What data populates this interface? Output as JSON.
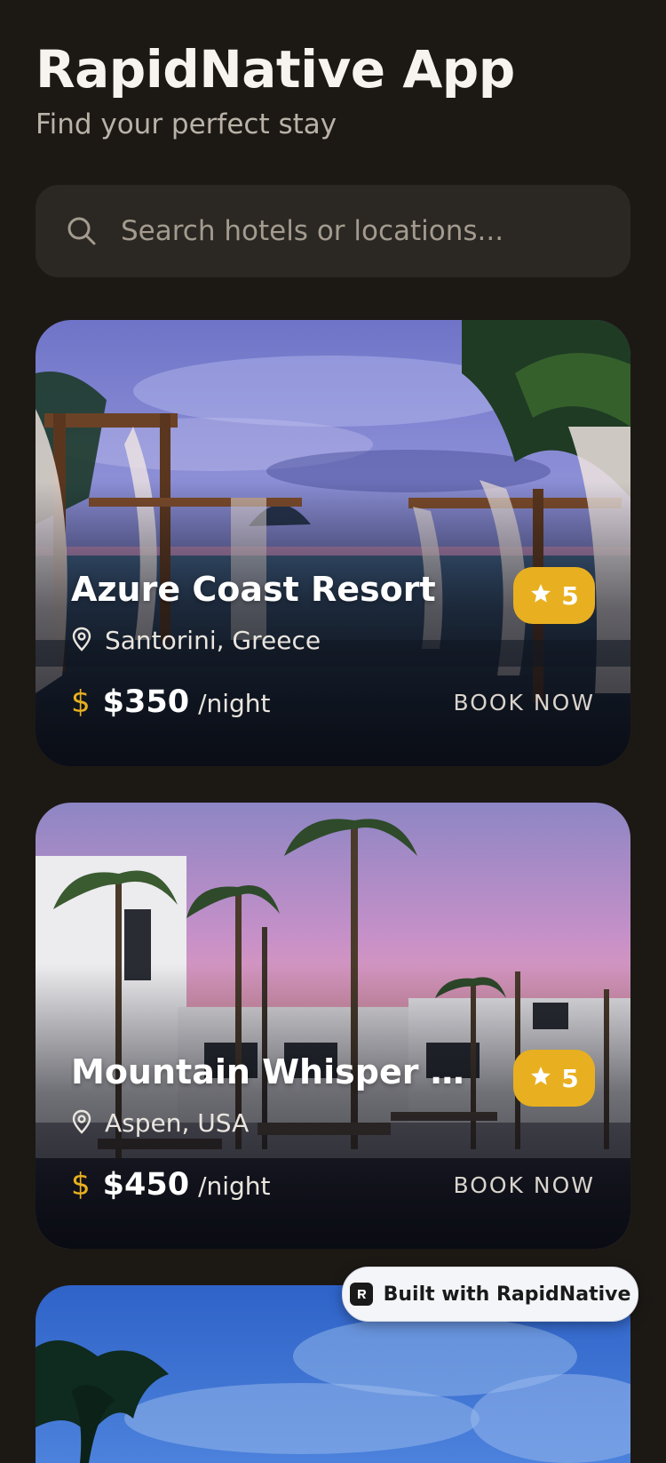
{
  "header": {
    "title": "RapidNative App",
    "subtitle": "Find your perfect stay"
  },
  "search": {
    "placeholder": "Search hotels or locations...",
    "icon": "search-icon"
  },
  "hotels": [
    {
      "name": "Azure Coast Resort",
      "rating": "5",
      "location": "Santorini, Greece",
      "price": "$350",
      "per_night": "/night",
      "cta": "BOOK NOW"
    },
    {
      "name": "Mountain Whisper Lodge",
      "rating": "5",
      "location": "Aspen, USA",
      "price": "$450",
      "per_night": "/night",
      "cta": "BOOK NOW"
    }
  ],
  "badge": {
    "label": "Built with RapidNative"
  },
  "colors": {
    "background": "#1c1915",
    "accent": "#e8b020",
    "search_bg": "#2b2722"
  }
}
